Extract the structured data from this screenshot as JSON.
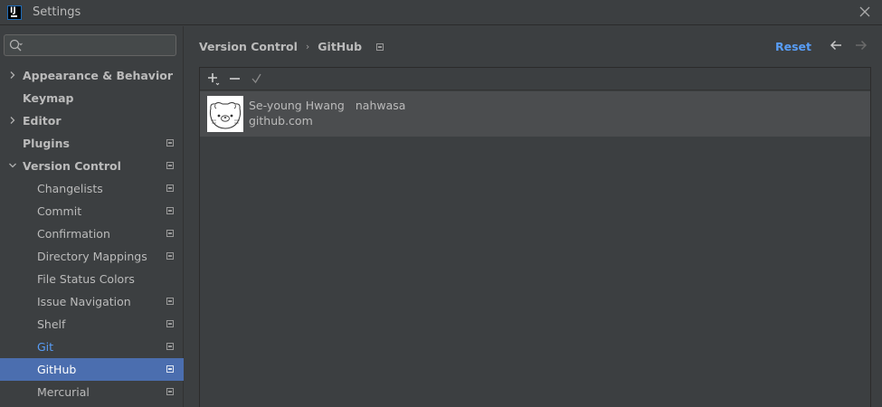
{
  "window": {
    "title": "Settings",
    "logo_letters": "IJ"
  },
  "search": {
    "value": "",
    "placeholder": ""
  },
  "sidebar": {
    "items": [
      {
        "label": "Appearance & Behavior",
        "expandable": true,
        "expanded": false,
        "project_icon": false
      },
      {
        "label": "Keymap",
        "expandable": false,
        "project_icon": false
      },
      {
        "label": "Editor",
        "expandable": true,
        "expanded": false,
        "project_icon": false
      },
      {
        "label": "Plugins",
        "expandable": false,
        "project_icon": true
      },
      {
        "label": "Version Control",
        "expandable": true,
        "expanded": true,
        "project_icon": true
      },
      {
        "label": "Changelists",
        "child": true,
        "project_icon": true
      },
      {
        "label": "Commit",
        "child": true,
        "project_icon": true
      },
      {
        "label": "Confirmation",
        "child": true,
        "project_icon": true
      },
      {
        "label": "Directory Mappings",
        "child": true,
        "project_icon": true
      },
      {
        "label": "File Status Colors",
        "child": true,
        "project_icon": false
      },
      {
        "label": "Issue Navigation",
        "child": true,
        "project_icon": true
      },
      {
        "label": "Shelf",
        "child": true,
        "project_icon": true
      },
      {
        "label": "Git",
        "child": true,
        "project_icon": true,
        "accent": true
      },
      {
        "label": "GitHub",
        "child": true,
        "project_icon": true,
        "selected": true
      },
      {
        "label": "Mercurial",
        "child": true,
        "project_icon": true
      }
    ]
  },
  "header": {
    "breadcrumb": [
      "Version Control",
      "GitHub"
    ],
    "reset_label": "Reset"
  },
  "toolbar": {
    "add_icon": "plus-icon",
    "remove_icon": "minus-icon",
    "default_icon": "checkmark-icon"
  },
  "accounts": [
    {
      "name": "Se-young Hwang",
      "login": "nahwasa",
      "server": "github.com"
    }
  ],
  "colors": {
    "accent": "#589df6",
    "selection": "#4b6eaf",
    "background": "#3c3f41"
  }
}
